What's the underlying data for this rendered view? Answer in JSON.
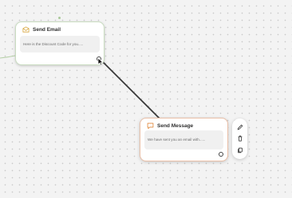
{
  "canvas": {
    "background": "#f3f3f3",
    "dot_color": "#c9c9c9"
  },
  "nodes": [
    {
      "id": "send-email",
      "title": "Send Email",
      "body": "Here is the Discount Code for you.....",
      "icon": "email-node-icon",
      "accent": "#d7a53b",
      "border": "#c9dcc0"
    },
    {
      "id": "send-message",
      "title": "Send Message",
      "body": "We have sent you an email with......",
      "icon": "chat-bubble-icon",
      "accent": "#e0893d",
      "border": "#e9bfa7"
    }
  ],
  "toolbar": {
    "items": [
      {
        "icon": "pencil-icon",
        "action": "edit"
      },
      {
        "icon": "trash-icon",
        "action": "delete"
      },
      {
        "icon": "copy-icon",
        "action": "duplicate"
      }
    ]
  },
  "edge_color": "#3a3a3a"
}
